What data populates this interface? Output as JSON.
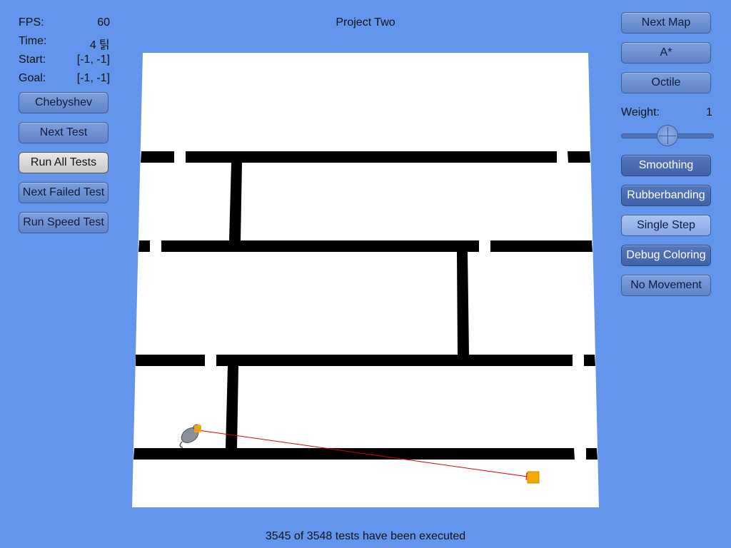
{
  "window": {
    "title": "Project Two"
  },
  "stats": [
    {
      "label": "FPS:",
      "value": "60"
    },
    {
      "label": "Time:",
      "value": "4 틹"
    },
    {
      "label": "Start:",
      "value": "[-1, -1]"
    },
    {
      "label": "Goal:",
      "value": "[-1, -1]"
    }
  ],
  "left_buttons": {
    "heuristic": "Chebyshev",
    "next_test": "Next Test",
    "run_all_tests": "Run All Tests",
    "next_failed_test": "Next Failed Test",
    "run_speed_test": "Run Speed Test"
  },
  "right_buttons": {
    "next_map": "Next Map",
    "algorithm": "A*",
    "distance": "Octile",
    "smoothing": "Smoothing",
    "rubberbanding": "Rubberbanding",
    "single_step": "Single Step",
    "debug_coloring": "Debug Coloring",
    "no_movement": "No Movement"
  },
  "weight": {
    "label": "Weight:",
    "value": "1",
    "slider_level": 0.5
  },
  "status": {
    "text": "3545 of 3548 tests have been executed"
  },
  "colors": {
    "background": "#6495ed",
    "floor": "#ffffff",
    "wall": "#000000",
    "path_line": "#dd0000",
    "goal_marker": "#f5a800"
  },
  "icons": {
    "agent": "rat-agent-icon",
    "goal": "goal-marker-icon"
  }
}
